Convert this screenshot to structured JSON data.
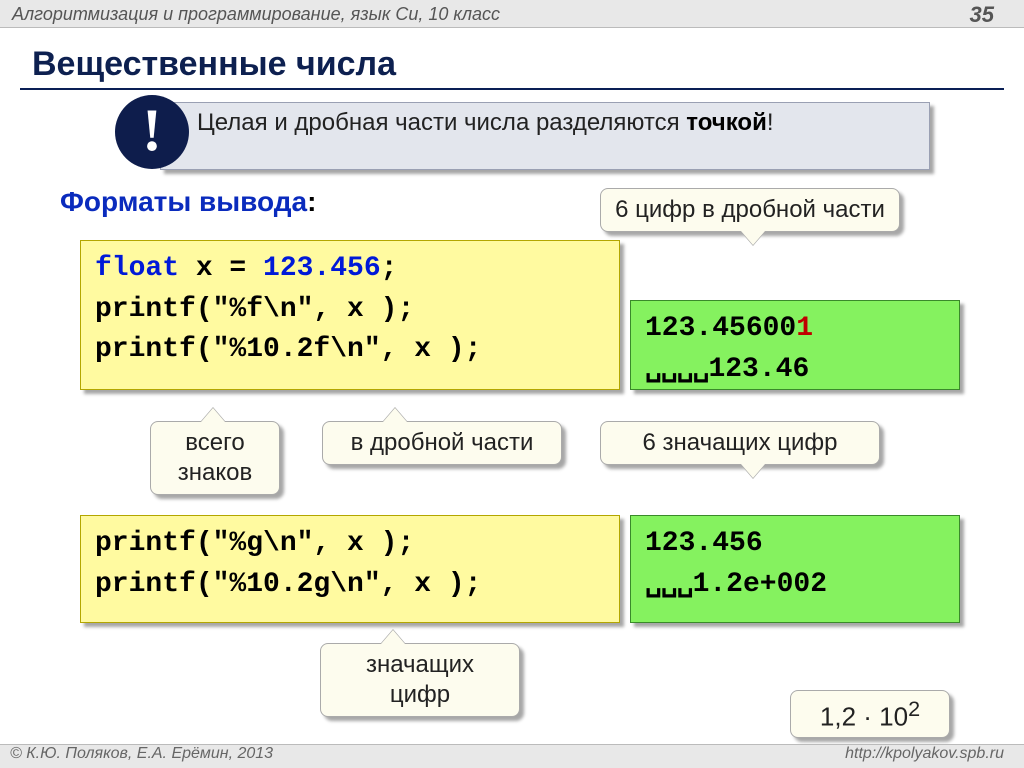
{
  "header": "Алгоритмизация и программирование, язык Си, 10 класс",
  "page": "35",
  "title": "Вещественные числа",
  "note": {
    "pre": "Целая и дробная части числа разделяются ",
    "bold": "точкой",
    "post": "!"
  },
  "subhead": "Форматы вывода",
  "code1": {
    "l1_kw": "float",
    "l1_var": " x = ",
    "l1_num": "123.456",
    "l1_semi": ";",
    "l2": "printf(\"%f\\n\", x );",
    "l3": "printf(\"%10.2f\\n\", x );"
  },
  "out1": {
    "l1a": "123.45600",
    "l1b": "1",
    "l2_pad": "␣␣␣␣",
    "l2_val": "123.46"
  },
  "code2": {
    "l1": "printf(\"%g\\n\", x );",
    "l2": "printf(\"%10.2g\\n\", x );"
  },
  "out2": {
    "l1": "123.456",
    "l2_pad": "␣␣␣",
    "l2_val": "1.2e+002"
  },
  "bubbles": {
    "top6": "6 цифр в дробной части",
    "vseh": "всего знаков",
    "drob": "в дробной части",
    "sixsig": "6 значащих цифр",
    "znach": "значащих цифр",
    "exp_a": "1,2 · 10",
    "exp_sup": "2"
  },
  "footer": {
    "left": "© К.Ю. Поляков, Е.А. Ерёмин, 2013",
    "right": "http://kpolyakov.spb.ru"
  },
  "badge": "!"
}
